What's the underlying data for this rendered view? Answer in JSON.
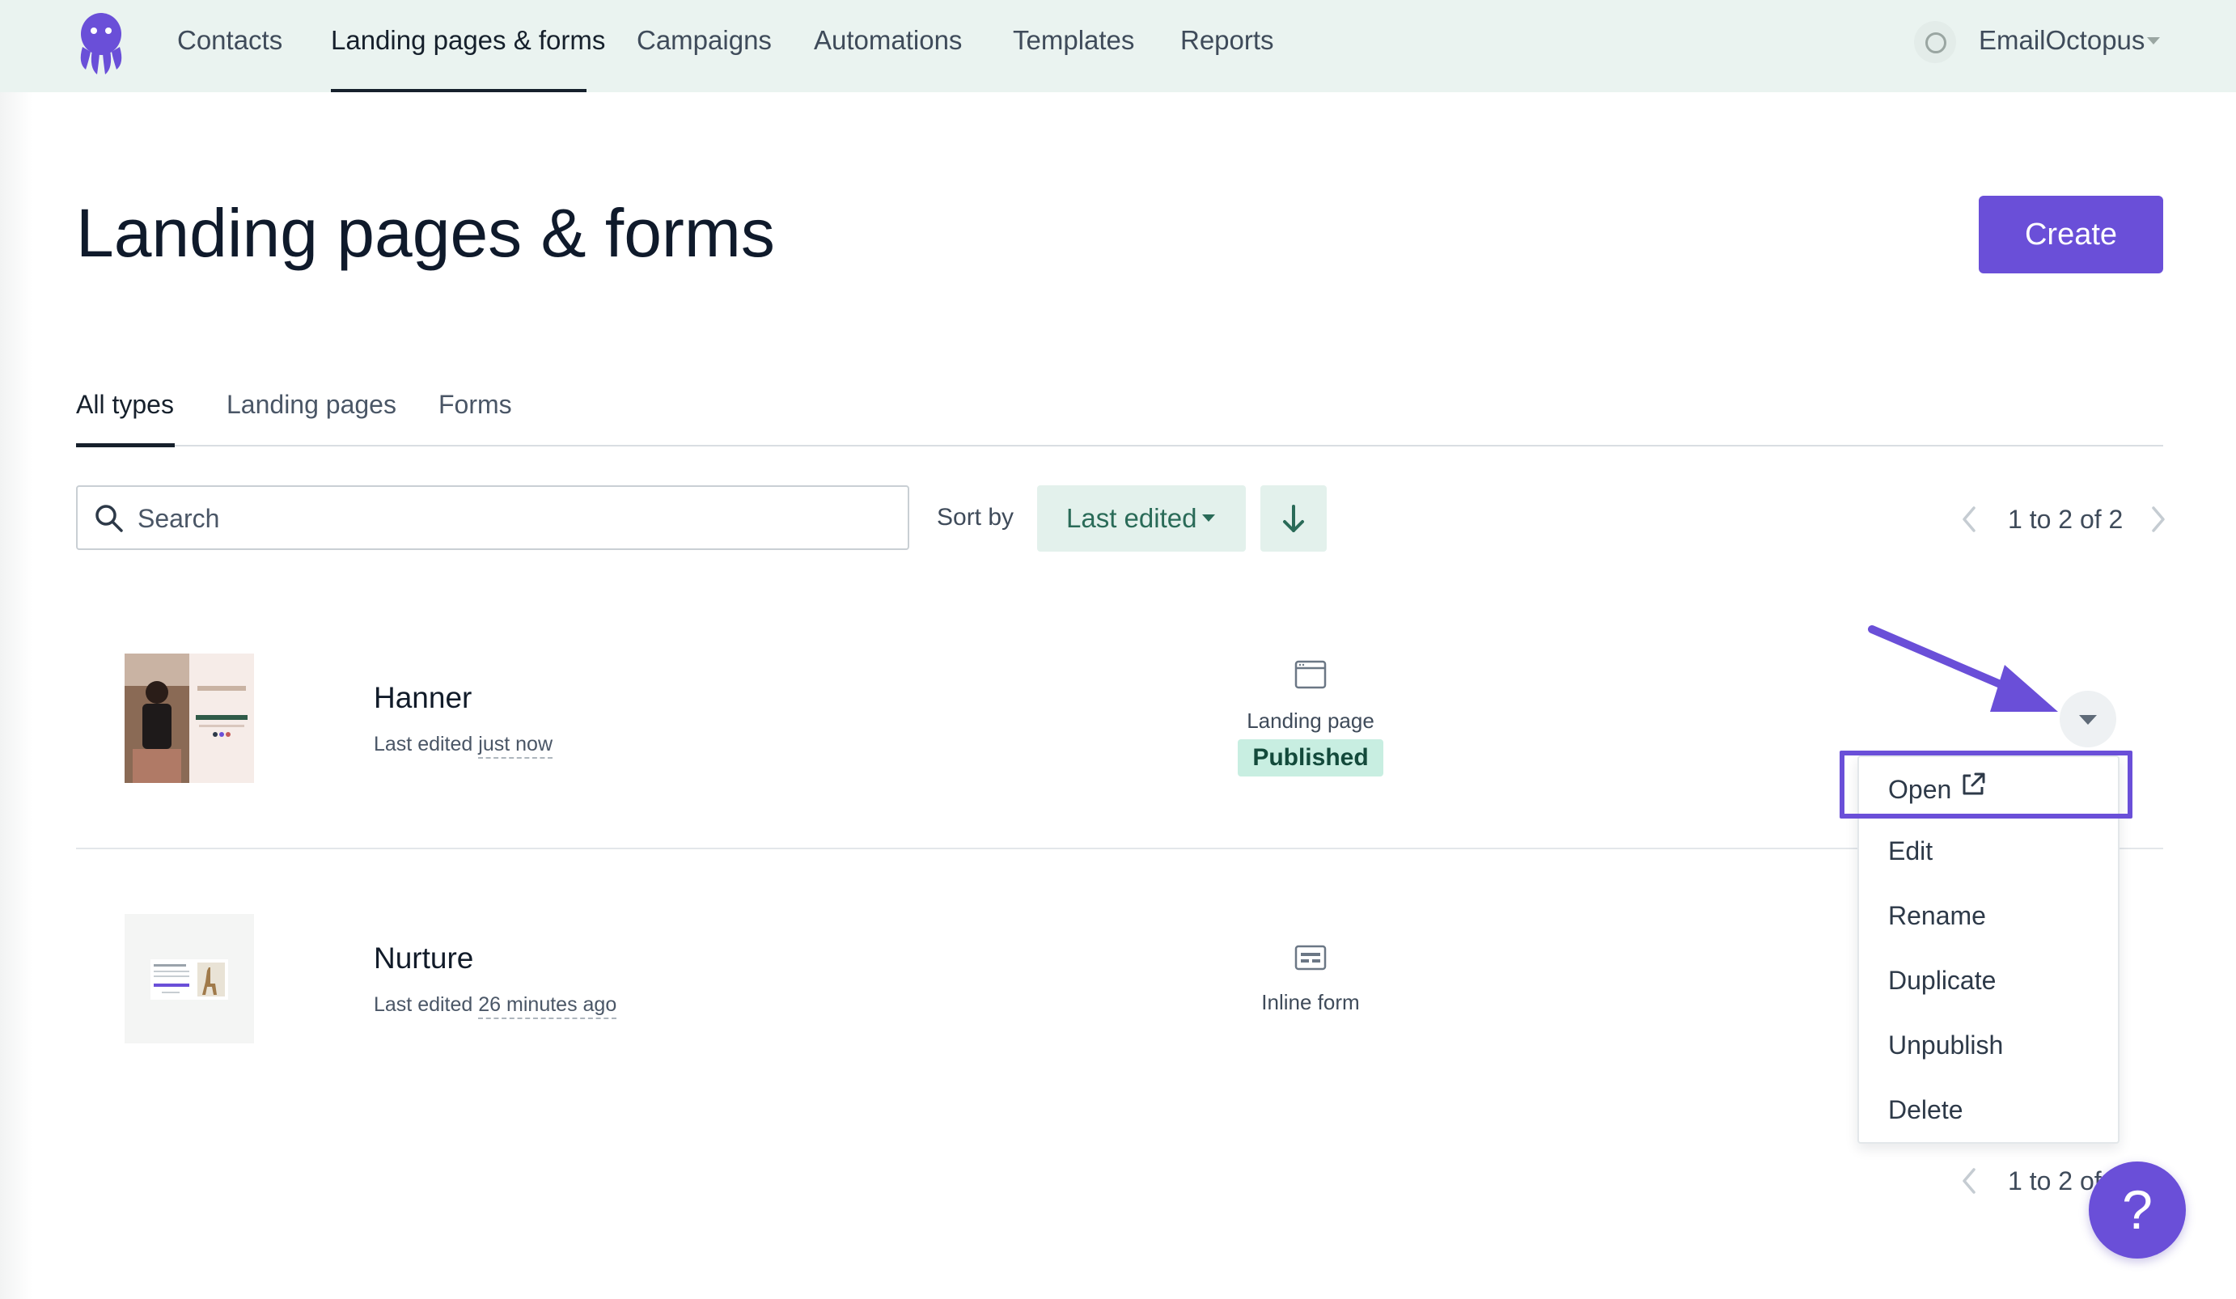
{
  "nav": {
    "items": [
      {
        "label": "Contacts"
      },
      {
        "label": "Landing pages & forms"
      },
      {
        "label": "Campaigns"
      },
      {
        "label": "Automations"
      },
      {
        "label": "Templates"
      },
      {
        "label": "Reports"
      }
    ],
    "active_index": 1,
    "account_name": "EmailOctopus"
  },
  "page": {
    "title": "Landing pages & forms",
    "create_label": "Create"
  },
  "tabs": [
    {
      "label": "All types"
    },
    {
      "label": "Landing pages"
    },
    {
      "label": "Forms"
    }
  ],
  "toolbar": {
    "search_placeholder": "Search",
    "sort_label": "Sort by",
    "sort_value": "Last edited",
    "pagination_top": "1 to 2 of 2",
    "pagination_bottom": "1 to 2 of 2"
  },
  "rows": [
    {
      "name": "Hanner",
      "edited_prefix": "Last edited",
      "edited_time": "just now",
      "type": "Landing page",
      "status": "Published"
    },
    {
      "name": "Nurture",
      "edited_prefix": "Last edited",
      "edited_time": "26 minutes ago",
      "type": "Inline form"
    }
  ],
  "menu": {
    "items": [
      {
        "label": "Open"
      },
      {
        "label": "Edit"
      },
      {
        "label": "Rename"
      },
      {
        "label": "Duplicate"
      },
      {
        "label": "Unpublish"
      },
      {
        "label": "Delete"
      }
    ]
  },
  "help_label": "?",
  "colors": {
    "accent": "#6a4fd8",
    "nav_bg": "#eaf3f0",
    "sort_bg": "#e3f1ec",
    "published_bg": "#c8eee1"
  }
}
